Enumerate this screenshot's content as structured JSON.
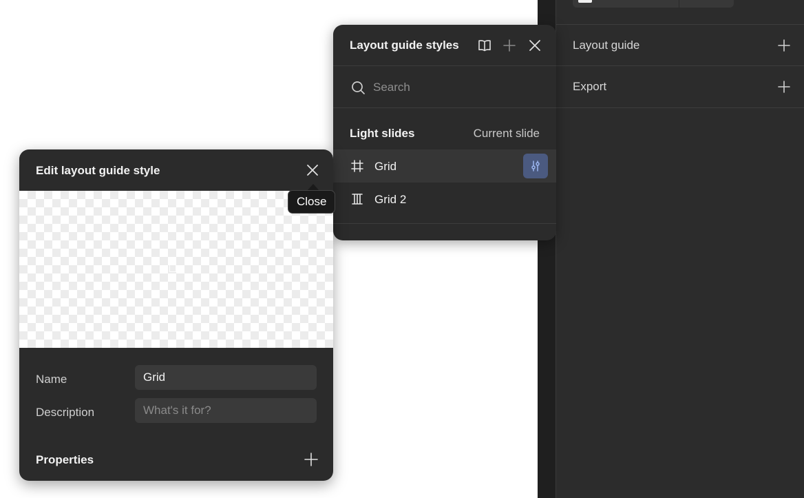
{
  "right_panel": {
    "rows": [
      {
        "label": "Layout guide",
        "action_icon": "plus-icon"
      },
      {
        "label": "Export",
        "action_icon": "plus-icon"
      }
    ]
  },
  "layout_guide_styles": {
    "title": "Layout guide styles",
    "header_icons": [
      "book-icon",
      "plus-icon",
      "close-icon"
    ],
    "search": {
      "placeholder": "Search",
      "value": ""
    },
    "section": {
      "title": "Light slides",
      "link": "Current slide"
    },
    "items": [
      {
        "label": "Grid",
        "icon": "grid-icon",
        "active": true,
        "edit_icon": "sliders-icon"
      },
      {
        "label": "Grid 2",
        "icon": "columns-icon",
        "active": false
      }
    ]
  },
  "edit_panel": {
    "title": "Edit layout guide style",
    "close_icon": "close-icon",
    "name": {
      "label": "Name",
      "value": "Grid"
    },
    "description": {
      "label": "Description",
      "placeholder": "What's it for?",
      "value": ""
    },
    "properties": {
      "title": "Properties",
      "action_icon": "plus-icon"
    }
  },
  "tooltip": {
    "text": "Close"
  },
  "colors": {
    "panel_bg": "#2b2b2b",
    "panel_border": "#3d3d3d",
    "active_row": "#363636",
    "edit_button_bg": "#4b5a80",
    "edit_button_icon": "#9cb6f0",
    "text_primary": "#f2f2f2",
    "text_muted": "#8e8e8e"
  }
}
